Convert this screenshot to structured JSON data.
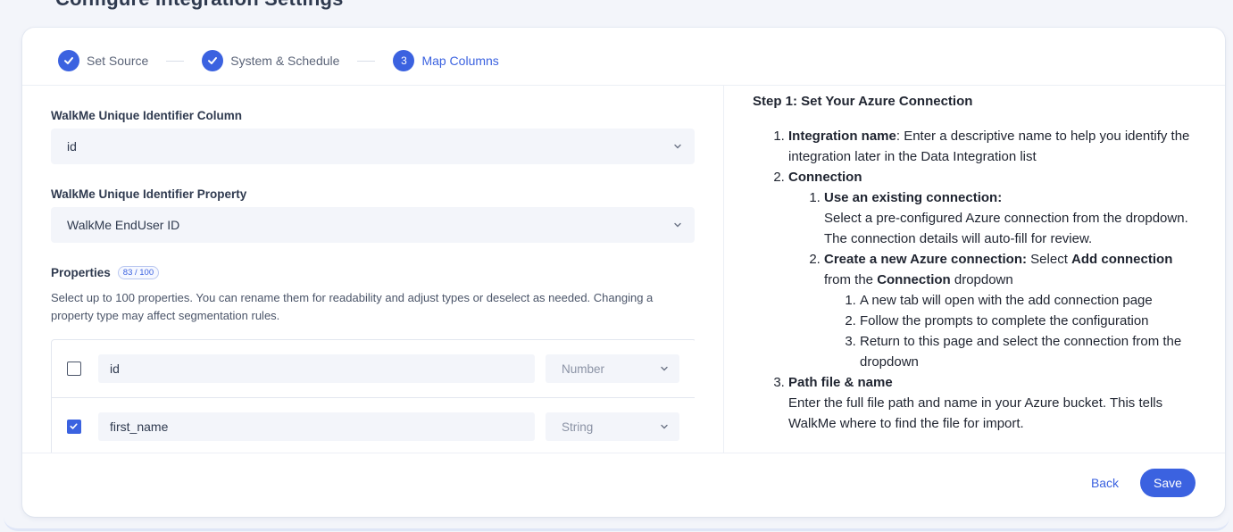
{
  "header": {
    "partial_title": "Configure Integration Settings"
  },
  "stepper": {
    "steps": [
      {
        "label": "Set Source",
        "state": "done"
      },
      {
        "label": "System & Schedule",
        "state": "done"
      },
      {
        "label": "Map Columns",
        "state": "active",
        "number": "3"
      }
    ]
  },
  "mapping": {
    "id_column_label": "WalkMe Unique Identifier Column",
    "id_column_value": "id",
    "id_property_label": "WalkMe Unique Identifier Property",
    "id_property_value": "WalkMe EndUser ID",
    "properties_label": "Properties",
    "properties_count": "83 / 100",
    "properties_description": "Select up to 100 properties. You can rename them for readability and adjust types or deselect as needed. Changing a property type may affect segmentation rules.",
    "rows": [
      {
        "name": "id",
        "type": "Number",
        "checked": false
      },
      {
        "name": "first_name",
        "type": "String",
        "checked": true
      }
    ]
  },
  "help": {
    "title": "Step 1: Set Your Azure Connection",
    "item1_bold": "Integration name",
    "item1_text": ": Enter a descriptive name to help you identify the integration later in the Data Integration list",
    "item2_bold": "Connection",
    "sub1_bold": "Use an existing connection:",
    "sub1_text": "Select a pre-configured Azure connection from the dropdown. The connection details will auto-fill for review.",
    "sub2_bold": "Create a new Azure connection:",
    "sub2_text1": " Select ",
    "sub2_bold2": "Add connection",
    "sub2_text2": " from the ",
    "sub2_bold3": "Connection",
    "sub2_text3": " dropdown",
    "subsub": [
      "A new tab will open with the add connection page",
      "Follow the prompts to complete the configuration",
      "Return to this page and select the connection from the dropdown"
    ],
    "item3_bold": "Path file & name",
    "item3_text": "Enter the full file path and name in your Azure bucket. This tells WalkMe where to find the file for import."
  },
  "footer": {
    "back_label": "Back",
    "save_label": "Save"
  },
  "colors": {
    "accent": "#3b62e0"
  }
}
